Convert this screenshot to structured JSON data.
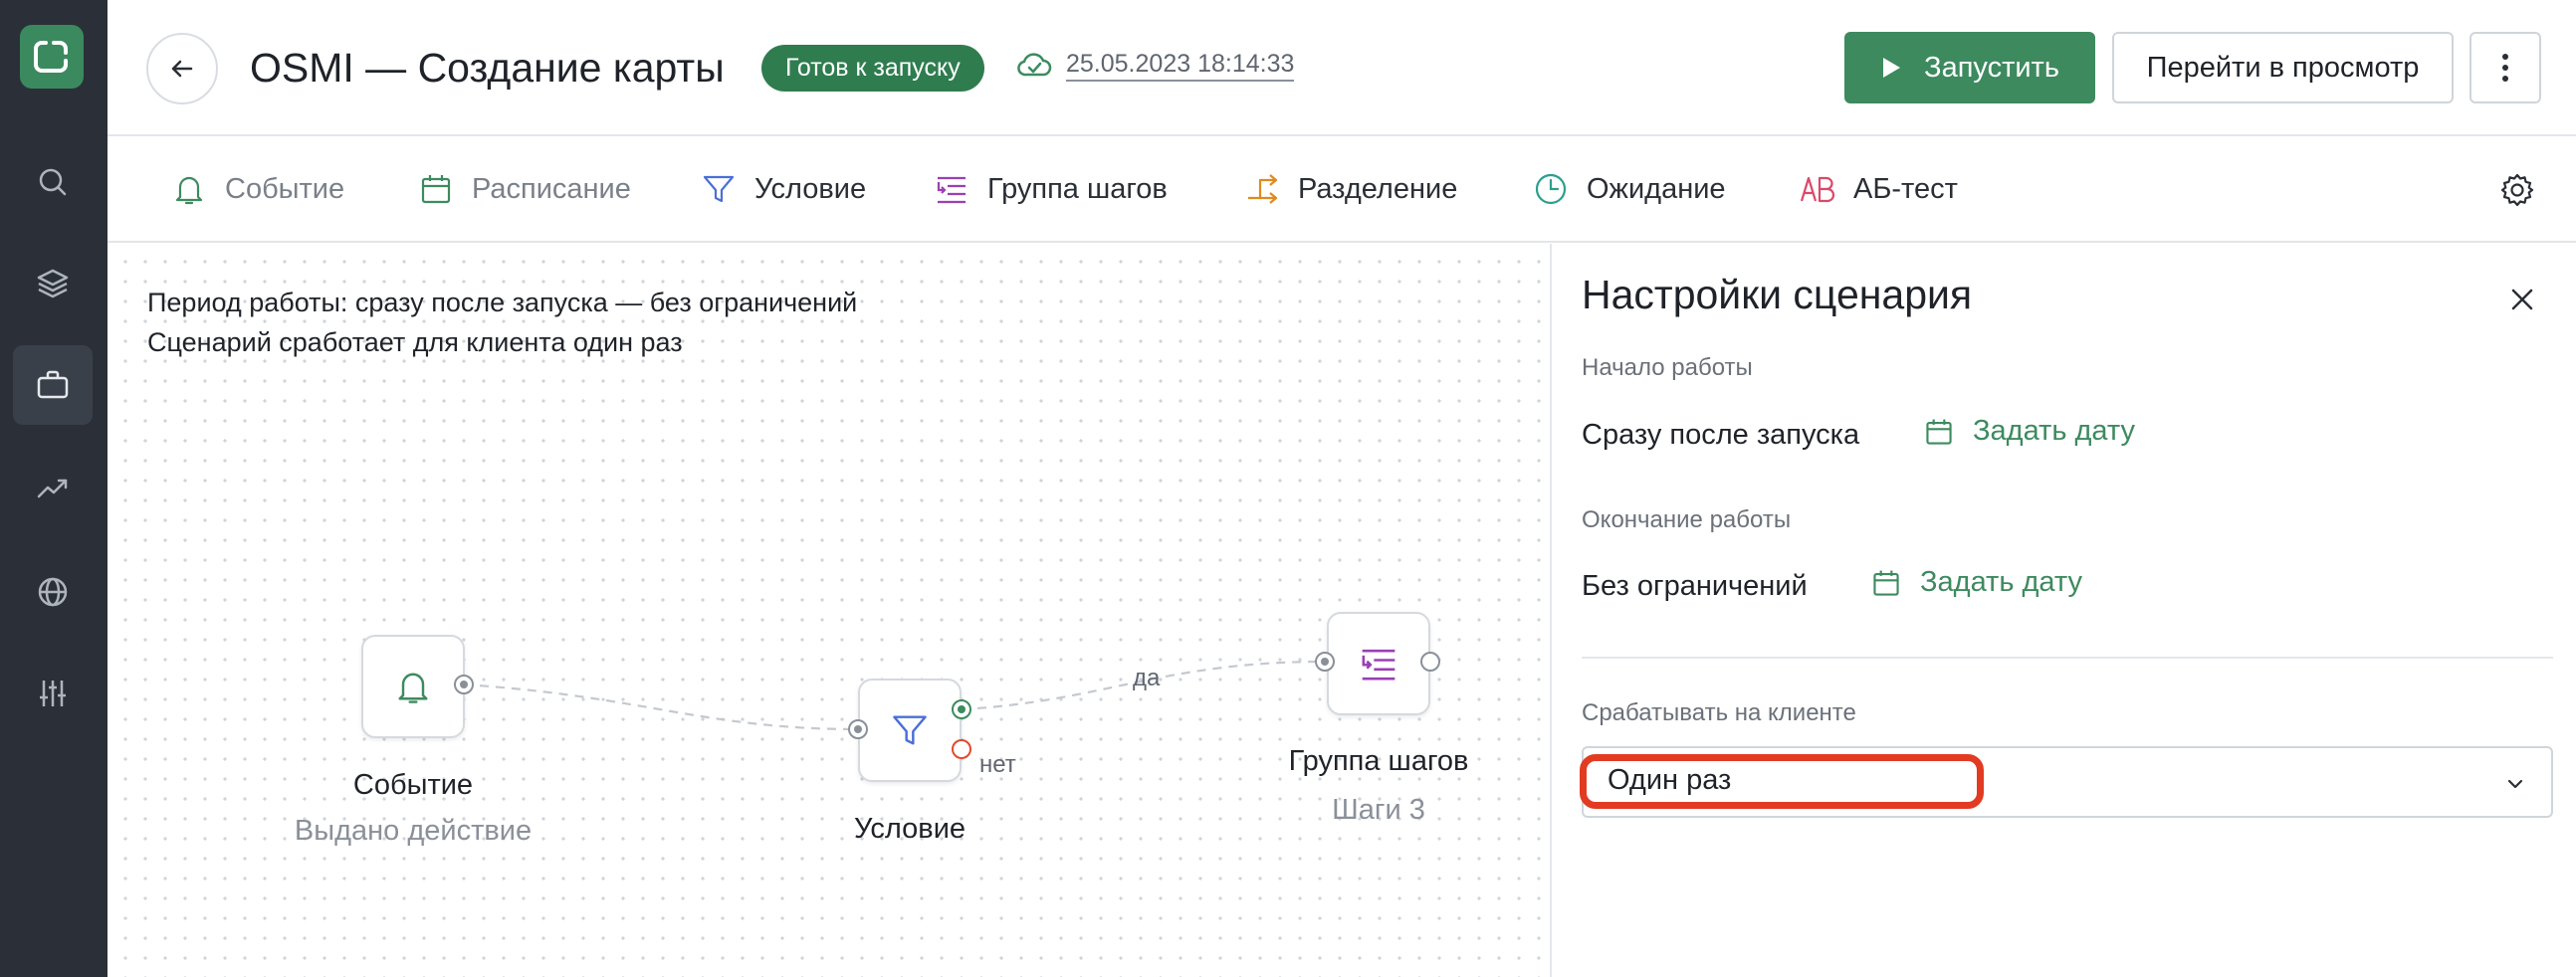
{
  "header": {
    "title": "OSMI — Создание карты",
    "status": "Готов к запуску",
    "saved_at": "25.05.2023 18:14:33",
    "run_label": "Запустить",
    "preview_label": "Перейти в просмотр"
  },
  "sidebar": {
    "items": [
      "search-icon",
      "layers-icon",
      "briefcase-icon",
      "trend-icon",
      "globe-icon",
      "sliders-icon"
    ],
    "active_item": "briefcase-icon"
  },
  "toolbar": {
    "items": [
      {
        "label": "Событие",
        "icon": "bell-icon"
      },
      {
        "label": "Расписание",
        "icon": "calendar-icon"
      },
      {
        "label": "Условие",
        "icon": "funnel-icon"
      },
      {
        "label": "Группа шагов",
        "icon": "step-group-icon"
      },
      {
        "label": "Разделение",
        "icon": "split-icon"
      },
      {
        "label": "Ожидание",
        "icon": "clock-icon"
      },
      {
        "label": "АБ-тест",
        "icon": "ab-icon"
      }
    ]
  },
  "canvas": {
    "info_period": "Период работы: сразу после запуска — без ограничений",
    "info_once": "Сценарий сработает для клиента один раз",
    "nodes": {
      "event": {
        "title": "Событие",
        "subtitle": "Выдано действие"
      },
      "condition": {
        "title": "Условие"
      },
      "group": {
        "title": "Группа шагов",
        "subtitle": "Шаги 3"
      }
    },
    "edge_yes": "да",
    "edge_no": "нет"
  },
  "panel": {
    "title": "Настройки сценария",
    "start_label": "Начало работы",
    "start_value": "Сразу после запуска",
    "end_label": "Окончание работы",
    "end_value": "Без ограничений",
    "set_date": "Задать дату",
    "trigger_label": "Срабатывать на клиенте",
    "trigger_value": "Один раз"
  },
  "colors": {
    "brand_green": "#3d8a5f",
    "sidebar_bg": "#2b3038",
    "highlight_red": "#e23b22",
    "purple_accent": "#9b3fb5",
    "orange_accent": "#e08a1e"
  }
}
